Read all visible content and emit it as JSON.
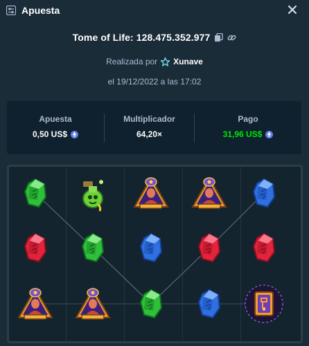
{
  "header": {
    "title": "Apuesta",
    "app_icon": "sliders-icon",
    "close_icon": "close-icon"
  },
  "bet": {
    "game_label": "Tome of Life: 128.475.352.977",
    "copy_icon": "copy-icon",
    "link_icon": "link-icon",
    "placed_by_label": "Realizada por",
    "user_icon": "vip-star-icon",
    "username": "Xunave",
    "date": "el 19/12/2022 a las 17:02"
  },
  "stats": {
    "bet_label": "Apuesta",
    "bet_value": "0,50 US$",
    "multiplier_label": "Multiplicador",
    "multiplier_value": "64,20×",
    "payout_label": "Pago",
    "payout_value": "31,96 US$",
    "currency_icon": "ethereum-icon",
    "payout_color": "#00e701"
  },
  "board": {
    "rows": [
      [
        "green-gem",
        "potion",
        "priestess",
        "priestess",
        "blue-gem"
      ],
      [
        "red-gem",
        "green-gem",
        "blue-gem",
        "red-gem",
        "red-gem"
      ],
      [
        "priestess",
        "priestess",
        "green-gem",
        "blue-gem",
        "tome"
      ]
    ]
  }
}
